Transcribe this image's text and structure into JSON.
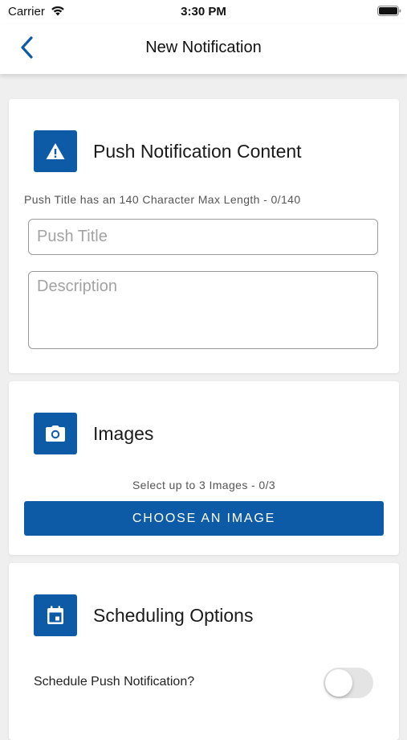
{
  "status_bar": {
    "carrier": "Carrier",
    "time": "3:30 PM",
    "wifi_icon": "wifi-icon",
    "battery_icon": "battery-icon"
  },
  "nav": {
    "title": "New Notification",
    "back_icon": "chevron-left-icon"
  },
  "colors": {
    "accent": "#0d5aa7",
    "background": "#efefef",
    "card": "#ffffff"
  },
  "content_section": {
    "title": "Push Notification Content",
    "icon": "warning-icon",
    "hint": "Push Title has an 140 Character Max Length - 0/140",
    "title_input": {
      "placeholder": "Push Title",
      "value": ""
    },
    "description_input": {
      "placeholder": "Description",
      "value": ""
    }
  },
  "images_section": {
    "title": "Images",
    "icon": "camera-icon",
    "hint": "Select up to 3 Images - 0/3",
    "button_label": "CHOOSE AN IMAGE"
  },
  "scheduling_section": {
    "title": "Scheduling Options",
    "icon": "calendar-icon",
    "toggle_label": "Schedule Push Notification?",
    "toggle_on": false
  }
}
